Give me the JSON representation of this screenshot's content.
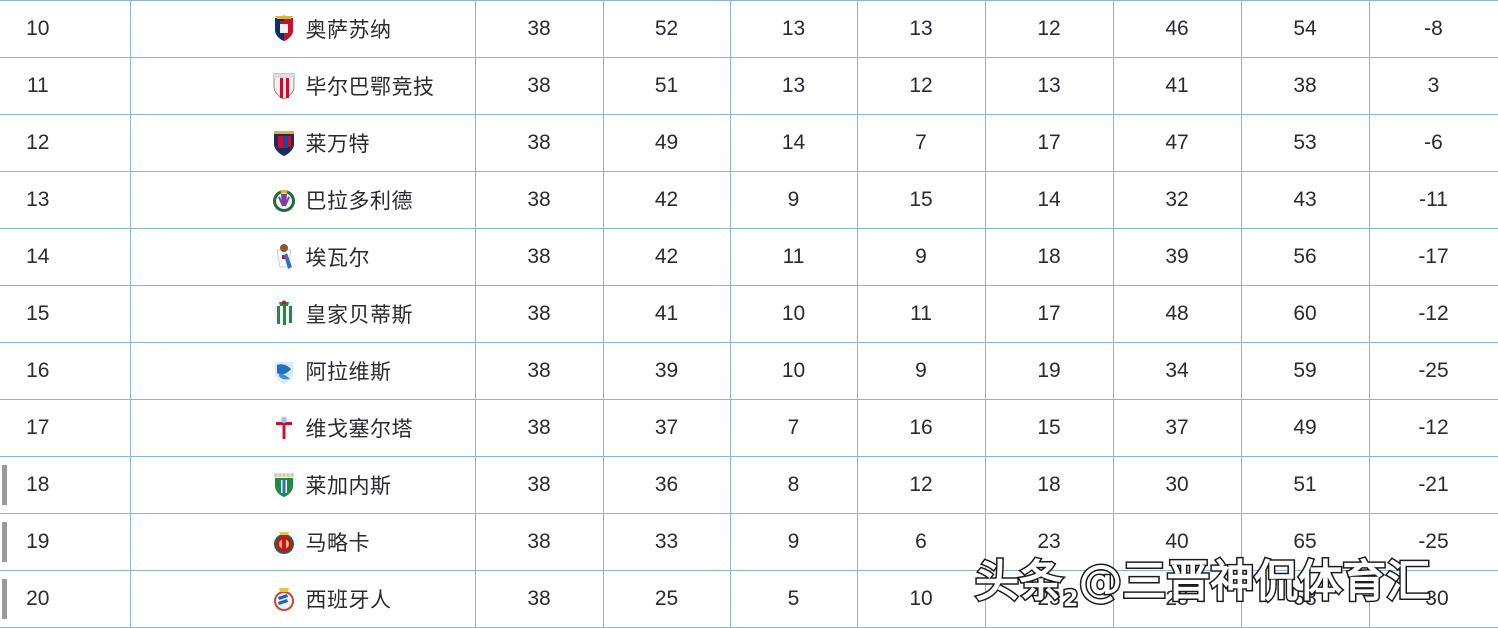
{
  "table": {
    "columns": [
      "rank",
      "team",
      "played",
      "points",
      "wins",
      "draws",
      "losses",
      "goals_for",
      "goals_against",
      "goal_diff"
    ],
    "rows": [
      {
        "rank": "10",
        "team": "奥萨苏纳",
        "crest": "osasuna-crest",
        "played": "38",
        "points": "52",
        "wins": "13",
        "draws": "13",
        "losses": "12",
        "goals_for": "46",
        "goals_against": "54",
        "goal_diff": "-8",
        "relegation": false
      },
      {
        "rank": "11",
        "team": "毕尔巴鄂竞技",
        "crest": "athletic-bilbao-crest",
        "played": "38",
        "points": "51",
        "wins": "13",
        "draws": "12",
        "losses": "13",
        "goals_for": "41",
        "goals_against": "38",
        "goal_diff": "3",
        "relegation": false
      },
      {
        "rank": "12",
        "team": "莱万特",
        "crest": "levante-crest",
        "played": "38",
        "points": "49",
        "wins": "14",
        "draws": "7",
        "losses": "17",
        "goals_for": "47",
        "goals_against": "53",
        "goal_diff": "-6",
        "relegation": false
      },
      {
        "rank": "13",
        "team": "巴拉多利德",
        "crest": "valladolid-crest",
        "played": "38",
        "points": "42",
        "wins": "9",
        "draws": "15",
        "losses": "14",
        "goals_for": "32",
        "goals_against": "43",
        "goal_diff": "-11",
        "relegation": false
      },
      {
        "rank": "14",
        "team": "埃瓦尔",
        "crest": "eibar-crest",
        "played": "38",
        "points": "42",
        "wins": "11",
        "draws": "9",
        "losses": "18",
        "goals_for": "39",
        "goals_against": "56",
        "goal_diff": "-17",
        "relegation": false
      },
      {
        "rank": "15",
        "team": "皇家贝蒂斯",
        "crest": "real-betis-crest",
        "played": "38",
        "points": "41",
        "wins": "10",
        "draws": "11",
        "losses": "17",
        "goals_for": "48",
        "goals_against": "60",
        "goal_diff": "-12",
        "relegation": false
      },
      {
        "rank": "16",
        "team": "阿拉维斯",
        "crest": "alaves-crest",
        "played": "38",
        "points": "39",
        "wins": "10",
        "draws": "9",
        "losses": "19",
        "goals_for": "34",
        "goals_against": "59",
        "goal_diff": "-25",
        "relegation": false
      },
      {
        "rank": "17",
        "team": "维戈塞尔塔",
        "crest": "celta-vigo-crest",
        "played": "38",
        "points": "37",
        "wins": "7",
        "draws": "16",
        "losses": "15",
        "goals_for": "37",
        "goals_against": "49",
        "goal_diff": "-12",
        "relegation": false
      },
      {
        "rank": "18",
        "team": "莱加内斯",
        "crest": "leganes-crest",
        "played": "38",
        "points": "36",
        "wins": "8",
        "draws": "12",
        "losses": "18",
        "goals_for": "30",
        "goals_against": "51",
        "goal_diff": "-21",
        "relegation": true
      },
      {
        "rank": "19",
        "team": "马略卡",
        "crest": "mallorca-crest",
        "played": "38",
        "points": "33",
        "wins": "9",
        "draws": "6",
        "losses": "23",
        "goals_for": "40",
        "goals_against": "65",
        "goal_diff": "-25",
        "relegation": true
      },
      {
        "rank": "20",
        "team": "西班牙人",
        "crest": "espanyol-crest",
        "played": "38",
        "points": "25",
        "wins": "5",
        "draws": "10",
        "losses": "23",
        "goals_for": "28",
        "goals_against": "58",
        "goal_diff": "-30",
        "relegation": true
      }
    ]
  },
  "watermark": {
    "prefix": "头条",
    "sub": "2",
    "text": "@三晋神侃体育汇"
  },
  "colors": {
    "grid_line": "#8cb4d8",
    "points_highlight": "#ececec",
    "relegation_marker": "#9a9a9a",
    "text": "#2a2a33"
  }
}
